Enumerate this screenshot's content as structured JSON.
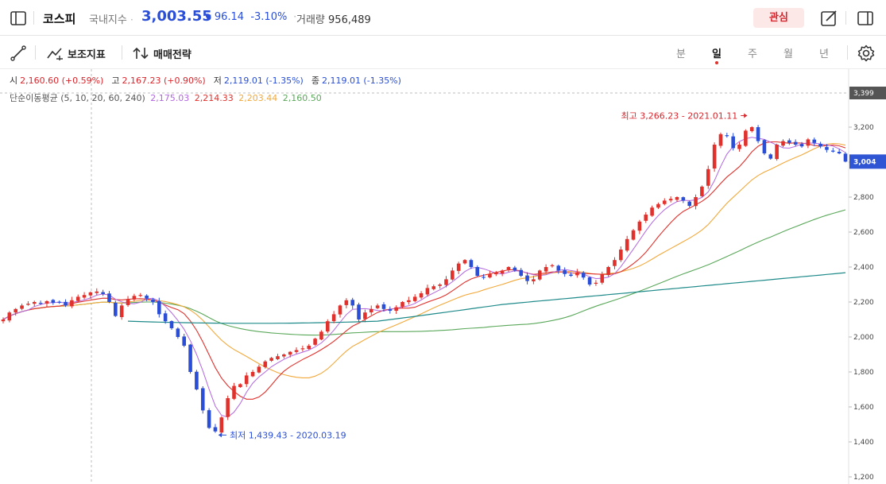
{
  "header": {
    "title": "코스피",
    "subtitle": "국내지수",
    "price": "3,003.55",
    "change_arrow": "▼",
    "change_value": "96.14",
    "change_pct": "-3.10%",
    "volume_label": "거래량",
    "volume_value": "956,489",
    "watch_label": "관심",
    "icons": [
      "sidebar-toggle-icon",
      "edit-icon",
      "panel-icon"
    ]
  },
  "toolbar": {
    "draw_tool_icon": "line-draw-icon",
    "indicator_label": "보조지표",
    "strategy_label": "매매전략",
    "periods": [
      "분",
      "일",
      "주",
      "월",
      "년"
    ],
    "active_period": "일",
    "settings_icon": "gear-icon"
  },
  "ohlc": {
    "open_label": "시",
    "open_value": "2,160.60 (+0.59%)",
    "high_label": "고",
    "high_value": "2,167.23 (+0.90%)",
    "low_label": "저",
    "low_value": "2,119.01 (-1.35%)",
    "close_label": "종",
    "close_value": "2,119.01 (-1.35%)"
  },
  "ma": {
    "label": "단순이동평균 (5, 10, 20, 60, 240)",
    "v5": "2,175.03",
    "v10": "2,214.33",
    "v20": "2,203.44",
    "v60": "2,160.50",
    "colors": {
      "ma5": "#b266e0",
      "ma10": "#e0312c",
      "ma20": "#f2a93b",
      "ma60": "#5aa85a",
      "ma240": "#1f8a8a"
    }
  },
  "chart_data": {
    "type": "candlestick",
    "ylim": [
      1200,
      3400
    ],
    "y_ticks": [
      "3,200",
      "3,000",
      "2,800",
      "2,600",
      "2,400",
      "2,200",
      "2,000",
      "1,800",
      "1,600",
      "1,400",
      "1,200"
    ],
    "y_tick_values": [
      3200,
      3000,
      2800,
      2600,
      2400,
      2200,
      2000,
      1800,
      1600,
      1400,
      1200
    ],
    "crosshair_value": "3,399",
    "current_value": "3,004",
    "high_annotation": "최고 3,266.23 - 2021.01.11",
    "low_annotation": "최저 1,439.43 - 2020.03.19",
    "closes": [
      2100,
      2140,
      2160,
      2180,
      2190,
      2200,
      2195,
      2205,
      2195,
      2200,
      2180,
      2210,
      2230,
      2240,
      2255,
      2260,
      2245,
      2200,
      2120,
      2180,
      2215,
      2235,
      2240,
      2220,
      2200,
      2130,
      2090,
      2050,
      2000,
      1950,
      1800,
      1700,
      1580,
      1480,
      1460,
      1540,
      1650,
      1720,
      1730,
      1780,
      1800,
      1830,
      1860,
      1880,
      1890,
      1900,
      1915,
      1925,
      1935,
      1950,
      1990,
      2030,
      2090,
      2130,
      2180,
      2210,
      2180,
      2100,
      2140,
      2160,
      2180,
      2160,
      2150,
      2170,
      2200,
      2210,
      2230,
      2250,
      2280,
      2290,
      2300,
      2330,
      2380,
      2420,
      2440,
      2400,
      2350,
      2340,
      2360,
      2370,
      2380,
      2400,
      2380,
      2350,
      2320,
      2330,
      2380,
      2400,
      2410,
      2380,
      2360,
      2350,
      2370,
      2340,
      2300,
      2310,
      2360,
      2400,
      2440,
      2500,
      2560,
      2610,
      2660,
      2700,
      2740,
      2760,
      2780,
      2790,
      2800,
      2780,
      2750,
      2800,
      2860,
      2960,
      3100,
      3160,
      3150,
      3080,
      3100,
      3180,
      3200,
      3120,
      3050,
      3020,
      3100,
      3120,
      3110,
      3100,
      3090,
      3130,
      3110,
      3090,
      3070,
      3060,
      3050,
      3003
    ]
  }
}
